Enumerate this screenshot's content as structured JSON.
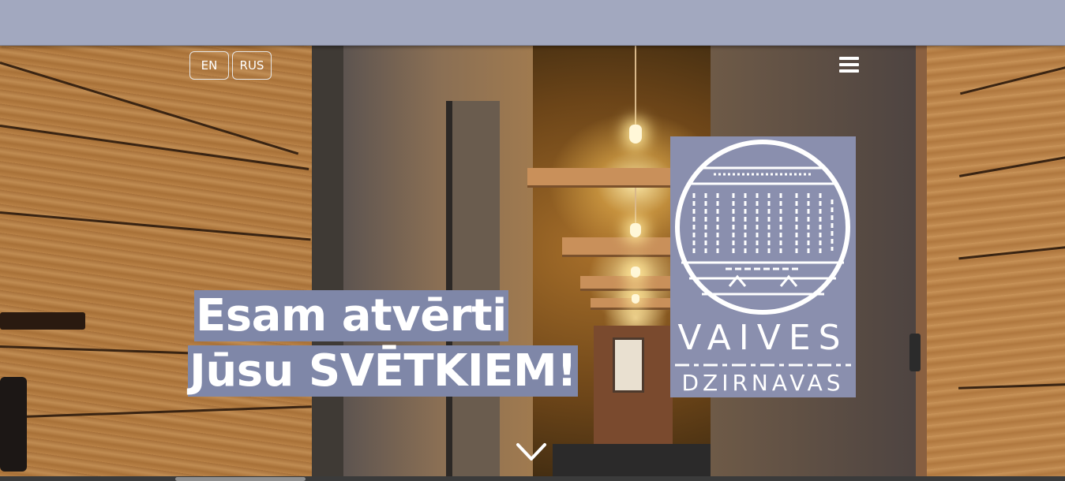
{
  "language_switcher": {
    "en_label": "EN",
    "rus_label": "RUS"
  },
  "hero": {
    "headline_line1": "Esam atvērti",
    "headline_line2": "Jūsu SVĒTKIEM!"
  },
  "logo": {
    "word1": "VAIVES",
    "word2": "DZIRNAVAS"
  },
  "icons": {
    "menu": "hamburger-menu-icon",
    "scroll": "chevron-down-icon"
  },
  "colors": {
    "topbar": "#a2a8bf",
    "highlight": "#7f87a8",
    "logo_bg": "#8a8fae",
    "text": "#ffffff"
  }
}
